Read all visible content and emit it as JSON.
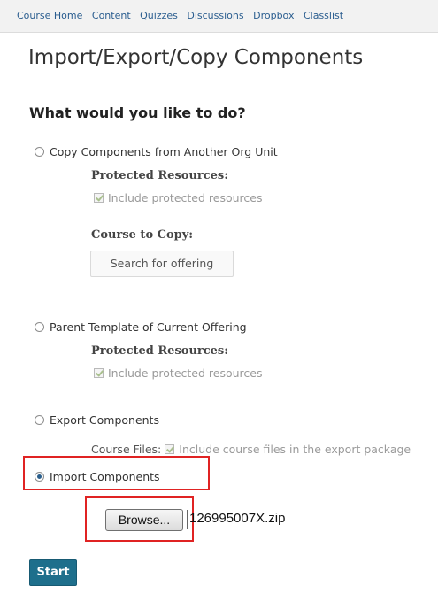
{
  "nav": {
    "items": [
      "Course Home",
      "Content",
      "Quizzes",
      "Discussions",
      "Dropbox",
      "Classlist"
    ]
  },
  "page": {
    "title": "Import/Export/Copy Components",
    "question": "What would you like to do?"
  },
  "options": {
    "copy": {
      "label": "Copy Components from Another Org Unit",
      "protected_heading": "Protected Resources:",
      "protected_checkbox": "Include protected resources",
      "course_to_copy_heading": "Course to Copy:",
      "search_button": "Search for offering"
    },
    "parent": {
      "label": "Parent Template of Current Offering",
      "protected_heading": "Protected Resources:",
      "protected_checkbox": "Include protected resources"
    },
    "export": {
      "label": "Export Components",
      "course_files_label": "Course Files:",
      "course_files_checkbox": "Include course files in the export package"
    },
    "import": {
      "label": "Import Components",
      "selected": true,
      "browse_button": "Browse...",
      "file_name": "126995007X.zip"
    }
  },
  "actions": {
    "start_button": "Start"
  },
  "colors": {
    "highlight": "#e02323",
    "start_button_bg": "#1e6f8c",
    "link": "#2a5d8f"
  }
}
